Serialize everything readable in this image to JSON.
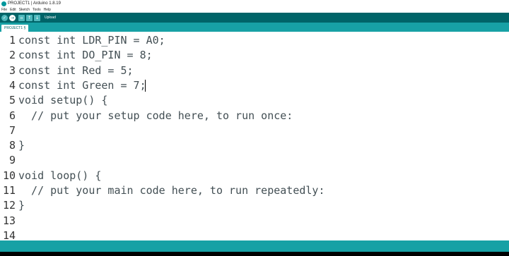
{
  "window": {
    "title": "PROJECT1 | Arduino 1.8.19"
  },
  "menu": [
    "File",
    "Edit",
    "Sketch",
    "Tools",
    "Help"
  ],
  "toolbar": {
    "hover_label": "Upload",
    "buttons": [
      {
        "name": "verify",
        "glyph": "✓"
      },
      {
        "name": "upload",
        "glyph": "→"
      },
      {
        "name": "new",
        "glyph": "▫"
      },
      {
        "name": "open",
        "glyph": "↑"
      },
      {
        "name": "save",
        "glyph": "↓"
      }
    ]
  },
  "tab": {
    "label": "PROJECT1 §"
  },
  "editor": {
    "lines": [
      {
        "num": "1",
        "text": "const int LDR_PIN = A0;"
      },
      {
        "num": "2",
        "text": "const int DO_PIN = 8;"
      },
      {
        "num": "3",
        "text": "const int Red = 5;"
      },
      {
        "num": "4",
        "text": "const int Green = 7;"
      },
      {
        "num": "5",
        "text": "void setup() {"
      },
      {
        "num": "6",
        "text": "  // put your setup code here, to run once:"
      },
      {
        "num": "7",
        "text": ""
      },
      {
        "num": "8",
        "text": "}"
      },
      {
        "num": "9",
        "text": ""
      },
      {
        "num": "10",
        "text": "void loop() {"
      },
      {
        "num": "11",
        "text": "  // put your main code here, to run repeatedly:"
      },
      {
        "num": "12",
        "text": "}"
      },
      {
        "num": "13",
        "text": ""
      },
      {
        "num": "14",
        "text": ""
      }
    ]
  },
  "colors": {
    "toolbar_bg": "#006468",
    "accent": "#17a1a5",
    "code_text": "#434f54"
  }
}
